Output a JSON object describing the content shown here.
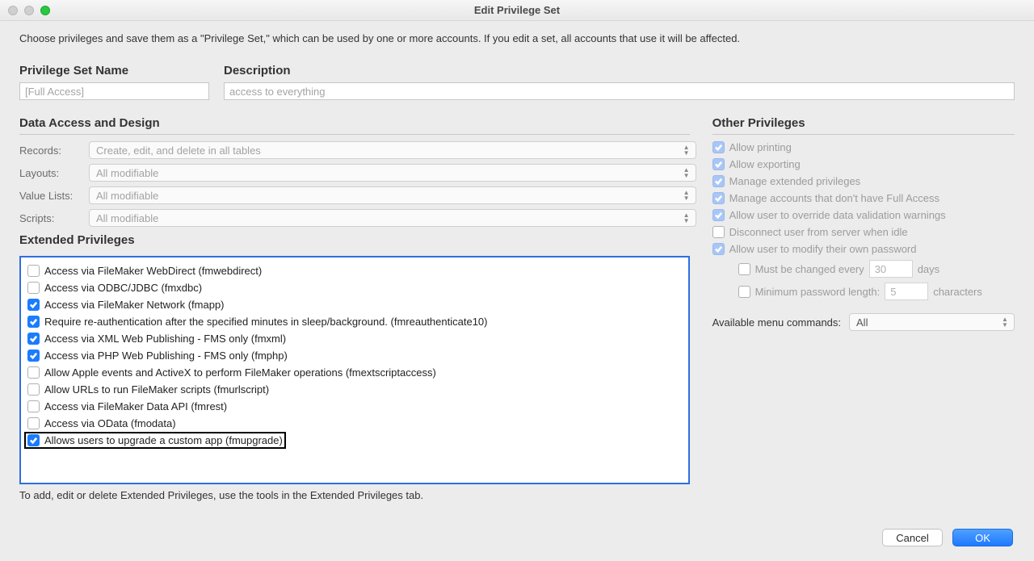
{
  "window": {
    "title": "Edit Privilege Set"
  },
  "intro": "Choose privileges and save them as a \"Privilege Set,\" which can be used by one or more accounts. If you edit a set, all accounts that use it will be affected.",
  "name_field": {
    "label": "Privilege Set Name",
    "value": "[Full Access]"
  },
  "desc_field": {
    "label": "Description",
    "value": "access to everything"
  },
  "data_access": {
    "heading": "Data Access and Design",
    "records": {
      "label": "Records:",
      "value": "Create, edit, and delete in all tables"
    },
    "layouts": {
      "label": "Layouts:",
      "value": "All modifiable"
    },
    "value_lists": {
      "label": "Value Lists:",
      "value": "All modifiable"
    },
    "scripts": {
      "label": "Scripts:",
      "value": "All modifiable"
    }
  },
  "extended": {
    "heading": "Extended Privileges",
    "caption": "To add, edit or delete Extended Privileges, use the tools in the Extended Privileges tab.",
    "items": [
      {
        "label": "Access via FileMaker WebDirect (fmwebdirect)",
        "checked": false
      },
      {
        "label": "Access via ODBC/JDBC (fmxdbc)",
        "checked": false
      },
      {
        "label": "Access via FileMaker Network (fmapp)",
        "checked": true
      },
      {
        "label": "Require re-authentication after the specified minutes in sleep/background. (fmreauthenticate10)",
        "checked": true
      },
      {
        "label": "Access via XML Web Publishing - FMS only (fmxml)",
        "checked": true
      },
      {
        "label": "Access via PHP Web Publishing - FMS only (fmphp)",
        "checked": true
      },
      {
        "label": "Allow Apple events and ActiveX to perform FileMaker operations (fmextscriptaccess)",
        "checked": false
      },
      {
        "label": "Allow URLs to run FileMaker scripts (fmurlscript)",
        "checked": false
      },
      {
        "label": "Access via FileMaker Data API (fmrest)",
        "checked": false
      },
      {
        "label": "Access via OData (fmodata)",
        "checked": false
      },
      {
        "label": "Allows users to upgrade a custom app (fmupgrade)",
        "checked": true,
        "highlight": true
      }
    ]
  },
  "other": {
    "heading": "Other Privileges",
    "printing": "Allow printing",
    "exporting": "Allow exporting",
    "manage_ext": "Manage extended privileges",
    "manage_accounts": "Manage accounts that don't have Full Access",
    "override_validation": "Allow user to override data validation warnings",
    "disconnect_idle": "Disconnect user from server when idle",
    "modify_password": "Allow user to modify their own password",
    "must_change": {
      "label": "Must be changed every",
      "value": "30",
      "suffix": "days"
    },
    "min_length": {
      "label": "Minimum password length:",
      "value": "5",
      "suffix": "characters"
    },
    "menu": {
      "label": "Available menu commands:",
      "value": "All"
    }
  },
  "buttons": {
    "cancel": "Cancel",
    "ok": "OK"
  }
}
